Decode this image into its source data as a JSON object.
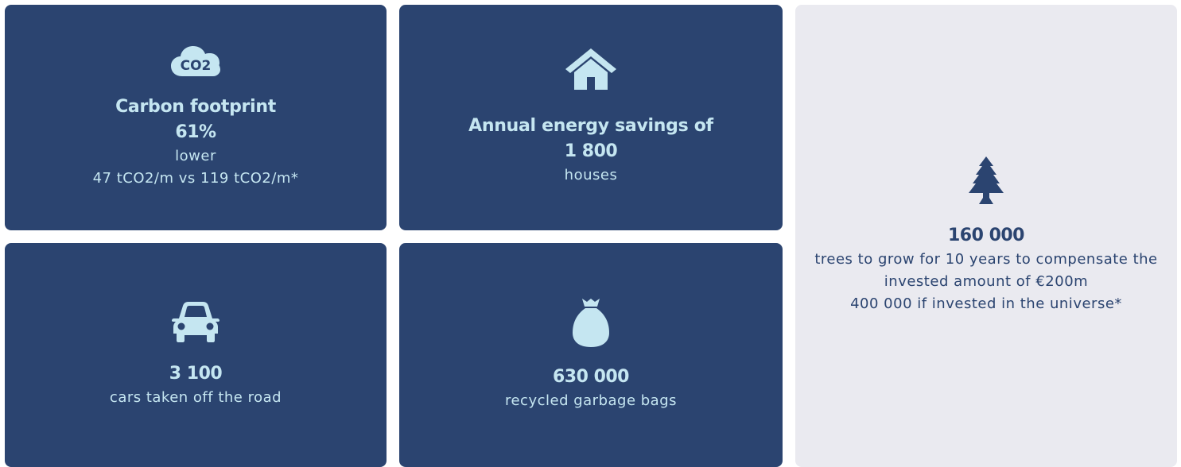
{
  "colors": {
    "card_dark": "#2b4470",
    "card_light": "#eaeaf0",
    "text_on_dark": "#c5e6f1",
    "text_on_light": "#2b4470"
  },
  "carbon": {
    "icon": "co2-cloud-icon",
    "icon_text": "CO2",
    "title": "Carbon footprint",
    "value": "61%",
    "desc1": "lower",
    "desc2": "47 tCO2/m vs 119 tCO2/m*"
  },
  "energy": {
    "icon": "house-icon",
    "title": "Annual energy savings of",
    "value": "1 800",
    "desc": "houses"
  },
  "cars": {
    "icon": "car-icon",
    "value": "3 100",
    "desc": "cars taken off the road"
  },
  "bags": {
    "icon": "garbage-bag-icon",
    "value": "630 000",
    "desc": "recycled garbage bags"
  },
  "trees": {
    "icon": "tree-icon",
    "value": "160 000",
    "desc1": "trees to grow for 10 years to compensate the",
    "desc2": "invested amount of €200m",
    "desc3": "400 000 if invested in the universe*"
  }
}
